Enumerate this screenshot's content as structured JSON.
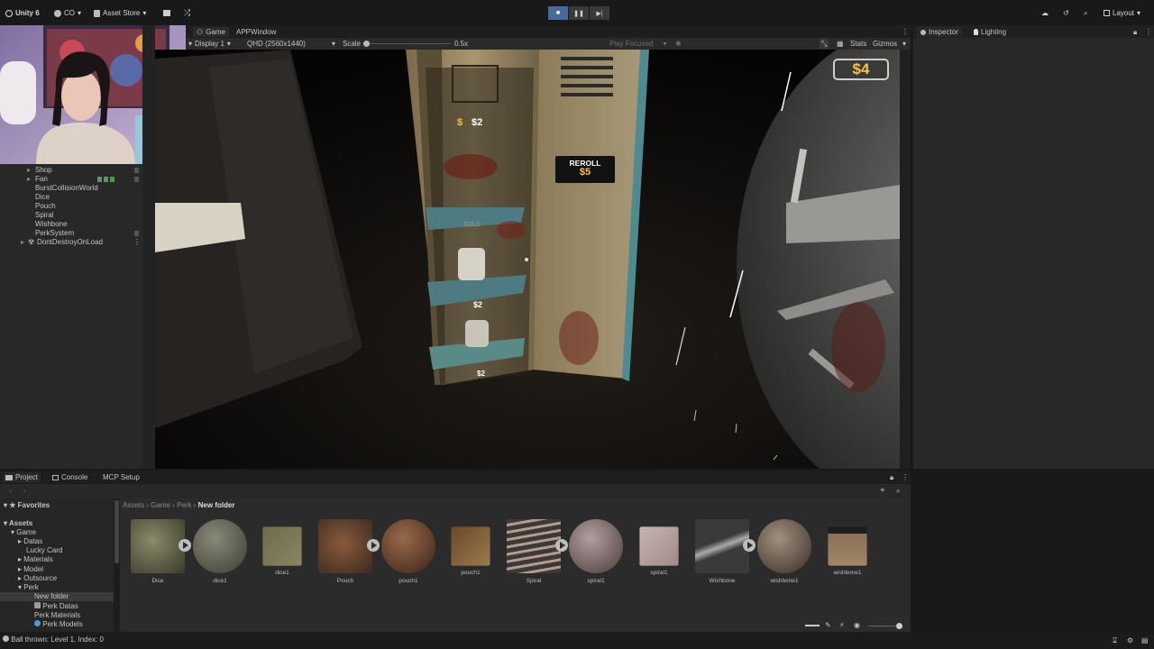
{
  "toolbar": {
    "unity": "Unity 6",
    "account": "CO",
    "asset_store": "Asset Store",
    "play_buttons": [
      "■",
      "❚❚",
      "▶|"
    ],
    "layout": "Layout"
  },
  "hierarchy": {
    "items": [
      "Shop",
      "Fan",
      "BurstCollisionWorld",
      "Dice",
      "Pouch",
      "Spiral",
      "Wishbone",
      "PerkSystem",
      "DontDestroyOnLoad"
    ]
  },
  "game": {
    "tabs": [
      "Game",
      "APPWindow"
    ],
    "display": "Display 1",
    "resolution": "QHD (2560x1440)",
    "scale_label": "Scale",
    "scale_value": "0.5x",
    "play_focused": "Play Focused",
    "stats": "Stats",
    "gizmos": "Gizmos",
    "hud_money": "$4",
    "price_top": "$2",
    "reroll_label": "REROLL",
    "reroll_price": "$5",
    "sold_label": "SOLD",
    "price_mid": "$2",
    "price_bottom": "$2"
  },
  "inspector": {
    "tabs": [
      "Inspector",
      "Lighting"
    ]
  },
  "project": {
    "tabs": [
      "Project",
      "Console",
      "MCP Setup"
    ],
    "favorites": "Favorites",
    "tree": [
      "Assets",
      "Game",
      "Datas",
      "Lucky Card",
      "Materials",
      "Model",
      "Outsource",
      "Perk",
      "New folder",
      "Perk Datas",
      "Perk Materials",
      "Perk Models"
    ],
    "breadcrumb": [
      "Assets",
      "Game",
      "Perk",
      "New folder"
    ],
    "assets": [
      "Dice",
      "dice1",
      "dice1",
      "Pouch",
      "pouch1",
      "pouch1",
      "Spiral",
      "spiral1",
      "spiral1",
      "Wishbone",
      "wishbone1",
      "wishbone1"
    ]
  },
  "status": {
    "message": "Ball thrown: Level 1, Index: 0"
  }
}
